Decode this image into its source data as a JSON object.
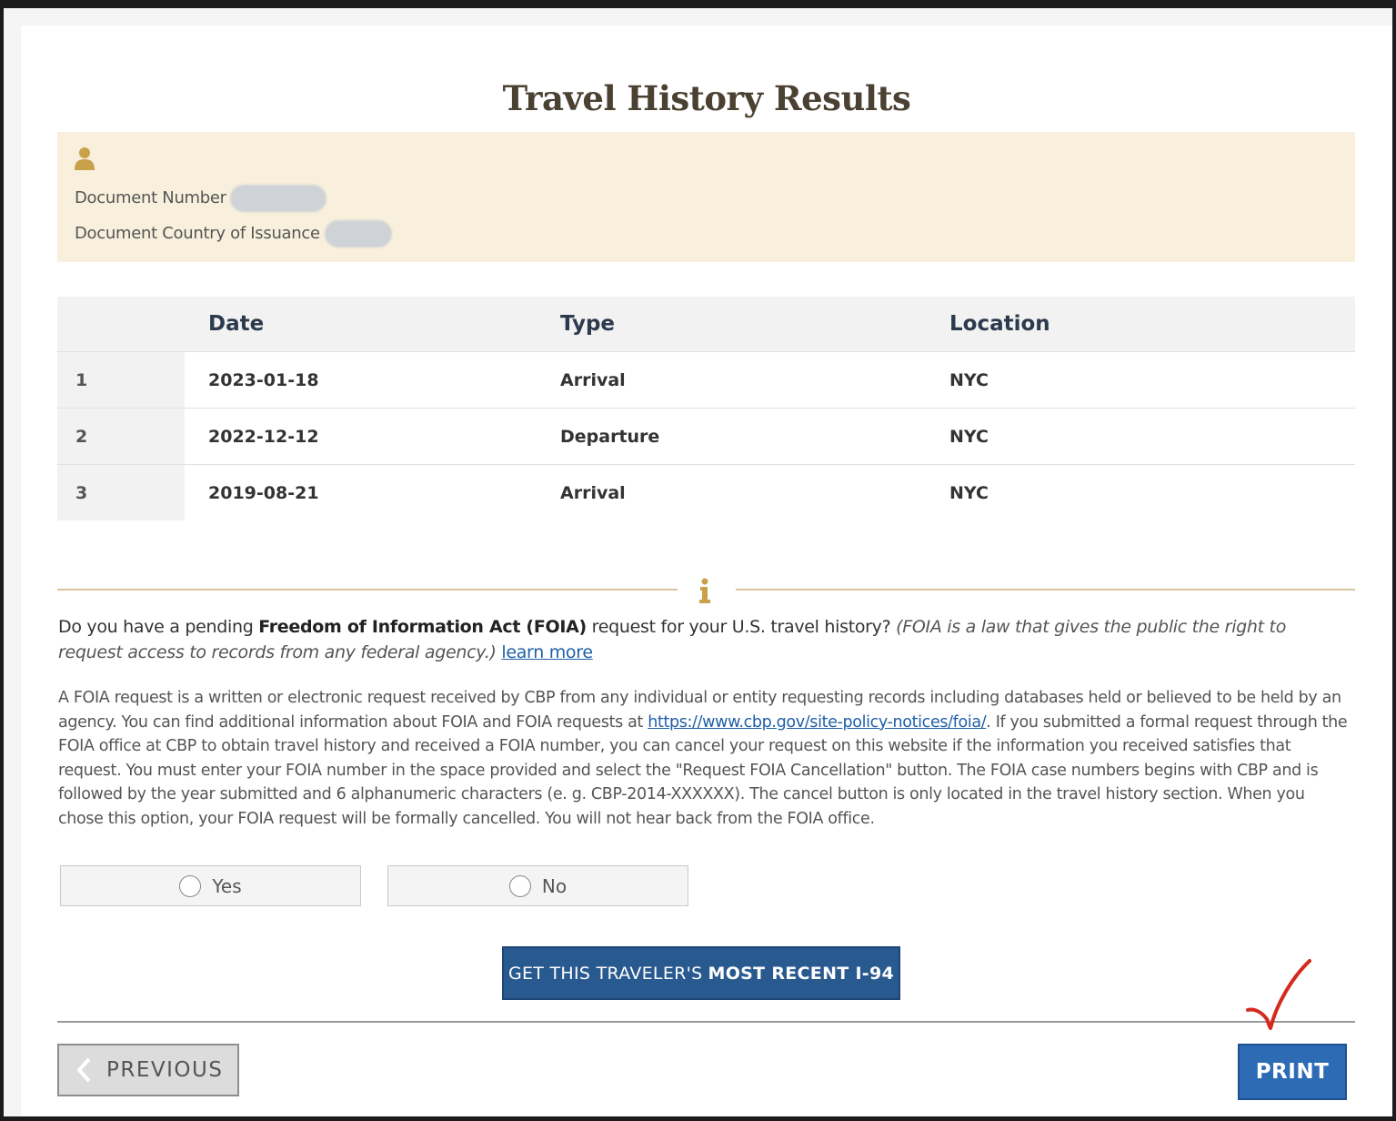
{
  "page": {
    "title": "Travel History Results"
  },
  "document": {
    "number_label": "Document Number",
    "country_label": "Document Country of Issuance :"
  },
  "table": {
    "headers": {
      "index": "",
      "date": "Date",
      "type": "Type",
      "location": "Location"
    },
    "rows": [
      {
        "index": "1",
        "date": "2023-01-18",
        "type": "Arrival",
        "location": "NYC"
      },
      {
        "index": "2",
        "date": "2022-12-12",
        "type": "Departure",
        "location": "NYC"
      },
      {
        "index": "3",
        "date": "2019-08-21",
        "type": "Arrival",
        "location": "NYC"
      }
    ]
  },
  "foia": {
    "question_prefix": "Do you have a pending ",
    "question_bold": "Freedom of Information Act (FOIA)",
    "question_suffix": " request for your U.S. travel history? ",
    "question_italic": "(FOIA is a law that gives the public the right to request access to records from any federal agency.)",
    "learn_more": "learn more",
    "body_part1": "A FOIA request is a written or electronic request received by CBP from any individual or entity requesting records including databases held or believed to be held by an agency. You can find additional information about FOIA and FOIA requests at ",
    "body_link": "https://www.cbp.gov/site-policy-notices/foia/",
    "body_part2": ". If you submitted a formal request through the FOIA office at CBP to obtain travel history and received a FOIA number, you can cancel your request on this website if the information you received satisfies that request. You must enter your FOIA number in the space provided and select the \"Request FOIA Cancellation\" button. The FOIA case numbers begins with CBP and is followed by the year submitted and 6 alphanumeric characters (e. g. CBP-2014-XXXXXX). The cancel button is only located in the travel history section. When you chose this option, your FOIA request will be formally cancelled. You will not hear back from the FOIA office.",
    "options": {
      "yes": "Yes",
      "no": "No"
    }
  },
  "actions": {
    "i94_prefix": "GET THIS TRAVELER'S",
    "i94_bold": "MOST RECENT I-94",
    "previous": "PREVIOUS",
    "print": "PRINT"
  },
  "colors": {
    "panel": "#f8f0dc",
    "accent_gold": "#c9a14a",
    "primary_blue": "#2d6bb5",
    "annotation_red": "#d42a1f"
  },
  "icons": [
    "person-icon",
    "info-icon",
    "chevron-left-icon",
    "checkmark-annotation"
  ]
}
